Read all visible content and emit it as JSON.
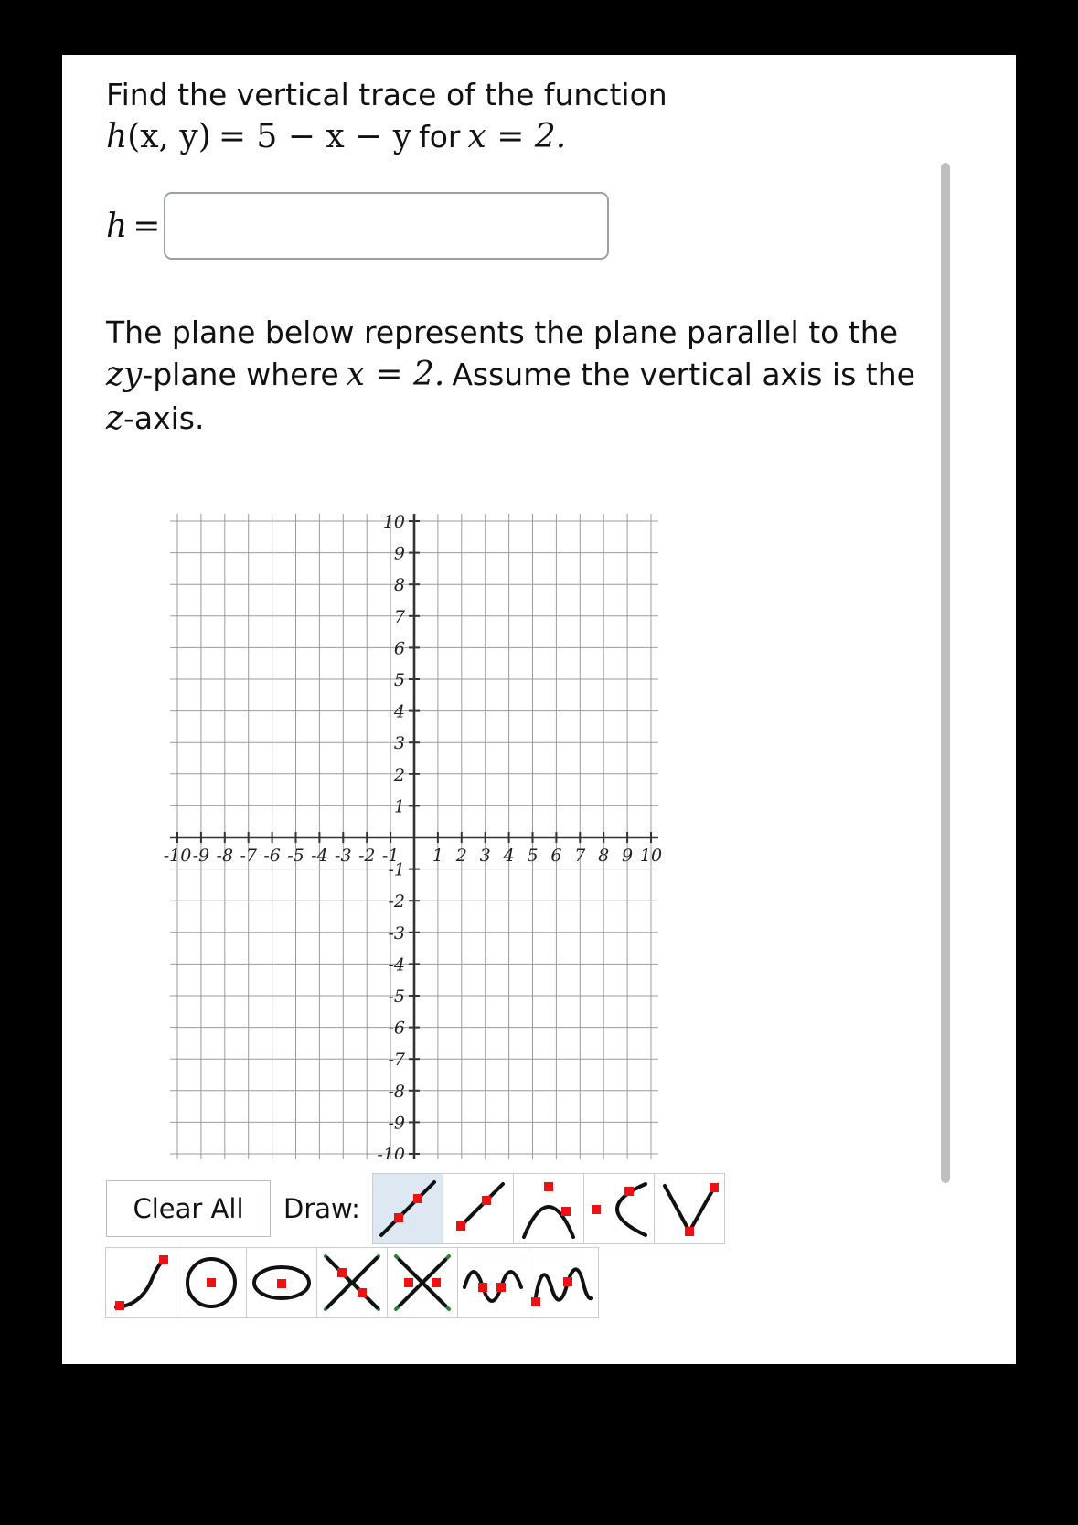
{
  "question": {
    "line1": "Find the vertical trace of the function",
    "func_h": "h",
    "func_args": "(x, y)",
    "func_eq": "= 5 − x − y",
    "func_for": "for",
    "func_cond": "x = 2.",
    "plain1": "Find the vertical trace of the function",
    "plain2_a": "The plane below represents the plane parallel to the",
    "plain2_b_pre": "-plane where",
    "plain2_b_var": "zy",
    "plain2_b_cond": "x = 2.",
    "plain2_b_post": "Assume the vertical axis is the",
    "plain2_c_var": "z",
    "plain2_c_post": "-axis."
  },
  "answer": {
    "label": "h",
    "equals": "=",
    "value": "",
    "placeholder": ""
  },
  "toolbar": {
    "clear_all_label": "Clear All",
    "draw_label": "Draw:",
    "selected_tool_index": 0,
    "tools_row1": [
      {
        "name": "line-tool",
        "title": "Line"
      },
      {
        "name": "ray-tool",
        "title": "Ray"
      },
      {
        "name": "parabola-vertical-tool",
        "title": "Parabola (vertical)"
      },
      {
        "name": "parabola-horizontal-tool",
        "title": "Parabola (horizontal)"
      },
      {
        "name": "absolute-value-tool",
        "title": "Absolute value"
      }
    ],
    "tools_row2": [
      {
        "name": "exponential-tool",
        "title": "Exponential"
      },
      {
        "name": "circle-tool",
        "title": "Circle"
      },
      {
        "name": "ellipse-tool",
        "title": "Ellipse"
      },
      {
        "name": "hyperbola-vertical-tool",
        "title": "Hyperbola (vertical)"
      },
      {
        "name": "hyperbola-horizontal-tool",
        "title": "Hyperbola (horizontal)"
      },
      {
        "name": "sine-tool",
        "title": "Sine"
      },
      {
        "name": "cosine-tool",
        "title": "Cosine"
      }
    ]
  },
  "chart_data": {
    "type": "scatter",
    "title": "",
    "xlabel": "",
    "ylabel": "",
    "xlim": [
      -10,
      10
    ],
    "ylim": [
      -10,
      10
    ],
    "grid": true,
    "x_ticks": [
      -10,
      -9,
      -8,
      -7,
      -6,
      -5,
      -4,
      -3,
      -2,
      -1,
      1,
      2,
      3,
      4,
      5,
      6,
      7,
      8,
      9,
      10
    ],
    "y_ticks": [
      10,
      9,
      8,
      7,
      6,
      5,
      4,
      3,
      2,
      1,
      -1,
      -2,
      -3,
      -4,
      -5,
      -6,
      -7,
      -8,
      -9,
      -10
    ],
    "x_tick_labels": [
      "-10",
      "-9",
      "-8",
      "-7",
      "-6",
      "-5",
      "-4",
      "-3",
      "-2",
      "-1",
      "1",
      "2",
      "3",
      "4",
      "5",
      "6",
      "7",
      "8",
      "9",
      "10"
    ],
    "y_tick_labels": [
      "10",
      "9",
      "8",
      "7",
      "6",
      "5",
      "4",
      "3",
      "2",
      "1",
      "-1",
      "-2",
      "-3",
      "-4",
      "-5",
      "-6",
      "-7",
      "-8",
      "-9",
      "-10"
    ],
    "series": [],
    "legend": null,
    "axis_color": "#333333",
    "grid_color": "#9b9b9b",
    "minor_grid_color": "#c8c8c8"
  },
  "colors": {
    "accent": "#dde8f3",
    "point": "#ee1111",
    "stroke": "#111111",
    "border": "#b9bcbe",
    "scrollbar": "#bfbfbf"
  },
  "scrollbar": {
    "name": "vertical-scrollbar"
  }
}
